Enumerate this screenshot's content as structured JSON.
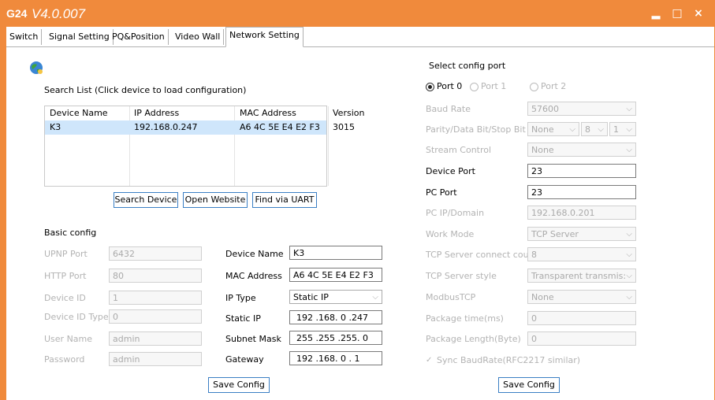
{
  "app": {
    "logo": "G24",
    "version": "V4.0.007"
  },
  "window_controls": {
    "minimize": "▂",
    "maximize": "□",
    "close": "×"
  },
  "tabs": [
    {
      "label": "Switch"
    },
    {
      "label": "Signal Setting"
    },
    {
      "label": "PQ&Position"
    },
    {
      "label": "Video Wall"
    },
    {
      "label": "Network Setting"
    }
  ],
  "search": {
    "title": "Search List (Click device to load configuration)",
    "columns": [
      "Device Name",
      "IP Address",
      "MAC Address",
      "Version"
    ],
    "rows": [
      [
        "K3",
        "192.168.0.247",
        "A6 4C 5E E4 E2 F3",
        "3015"
      ]
    ],
    "buttons": {
      "search": "Search Device",
      "website": "Open Website",
      "uart": "Find via UART"
    }
  },
  "basic": {
    "title": "Basic config",
    "upnp_label": "UPNP Port",
    "upnp_value": "6432",
    "http_label": "HTTP Port",
    "http_value": "80",
    "devid_label": "Device ID",
    "devid_value": "1",
    "devtype_label": "Device ID Type",
    "devtype_value": "0",
    "user_label": "User Name",
    "user_value": "admin",
    "pass_label": "Password",
    "pass_value": "admin",
    "devname_label": "Device Name",
    "devname_value": "K3",
    "mac_label": "MAC Address",
    "mac_value": "A6 4C 5E E4 E2 F3",
    "iptype_label": "IP Type",
    "iptype_value": "Static IP",
    "staticip_label": "Static IP",
    "staticip_value": "192 .168.  0  .247",
    "mask_label": "Subnet Mask",
    "mask_value": "255 .255 .255.  0",
    "gw_label": "Gateway",
    "gw_value": "192 .168.  0  .  1",
    "save": "Save Config"
  },
  "port": {
    "title": "Select config port",
    "radios": [
      "Port 0",
      "Port 1",
      "Port 2"
    ],
    "selected": "Port 0",
    "baud_label": "Baud Rate",
    "baud_value": "57600",
    "parity_label": "Parity/Data Bit/Stop Bit",
    "parity_value": "None",
    "databit_value": "8",
    "stopbit_value": "1",
    "stream_label": "Stream Control",
    "stream_value": "None",
    "devport_label": "Device Port",
    "devport_value": "23",
    "pcport_label": "PC Port",
    "pcport_value": "23",
    "pcip_label": "PC IP/Domain",
    "pcip_value": "192.168.0.201",
    "work_label": "Work Mode",
    "work_value": "TCP Server",
    "tcpconn_label": "TCP Server connect cou",
    "tcpconn_value": "8",
    "tcpstyle_label": "TCP Server style",
    "tcpstyle_value": "Transparent transmis:",
    "modbus_label": "ModbusTCP",
    "modbus_value": "None",
    "pkgtime_label": "Package time(ms)",
    "pkgtime_value": "0",
    "pkglen_label": "Package Length(Byte)",
    "pkglen_value": "0",
    "sync_label": "Sync BaudRate(RFC2217 similar)",
    "save": "Save Config"
  },
  "colors": {
    "title_bar": "#f08a3c",
    "selection": "#cfe6fb",
    "button_border": "#3b7fc4"
  }
}
